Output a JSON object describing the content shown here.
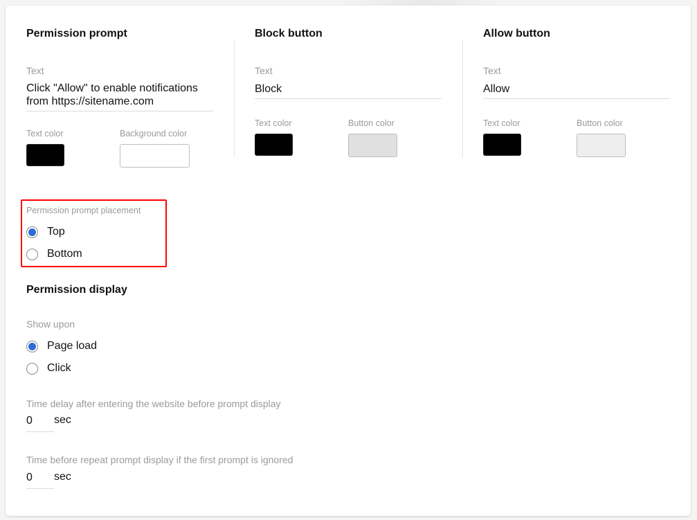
{
  "permission_prompt": {
    "title": "Permission prompt",
    "text_label": "Text",
    "text_value": "Click \"Allow\" to enable notifications from https://sitename.com",
    "text_color_label": "Text color",
    "text_color": "#000000",
    "background_color_label": "Background color",
    "background_color": "#ffffff"
  },
  "block_button": {
    "title": "Block button",
    "text_label": "Text",
    "text_value": "Block",
    "text_color_label": "Text color",
    "text_color": "#000000",
    "button_color_label": "Button color",
    "button_color": "#e0e0e0"
  },
  "allow_button": {
    "title": "Allow button",
    "text_label": "Text",
    "text_value": "Allow",
    "text_color_label": "Text color",
    "text_color": "#000000",
    "button_color_label": "Button color",
    "button_color": "#eeeeee"
  },
  "placement": {
    "label": "Permission prompt placement",
    "options": [
      {
        "label": "Top",
        "checked": true
      },
      {
        "label": "Bottom",
        "checked": false
      }
    ],
    "highlight_color": "#ff0000"
  },
  "permission_display": {
    "title": "Permission display",
    "show_upon_label": "Show upon",
    "options": [
      {
        "label": "Page load",
        "checked": true
      },
      {
        "label": "Click",
        "checked": false
      }
    ],
    "delay_label": "Time delay after entering the website before prompt display",
    "delay_value": "0",
    "delay_unit": "sec",
    "repeat_label": "Time before repeat prompt display if the first prompt is ignored",
    "repeat_value": "0",
    "repeat_unit": "sec"
  },
  "colors": {
    "accent": "#2f6bd6"
  }
}
